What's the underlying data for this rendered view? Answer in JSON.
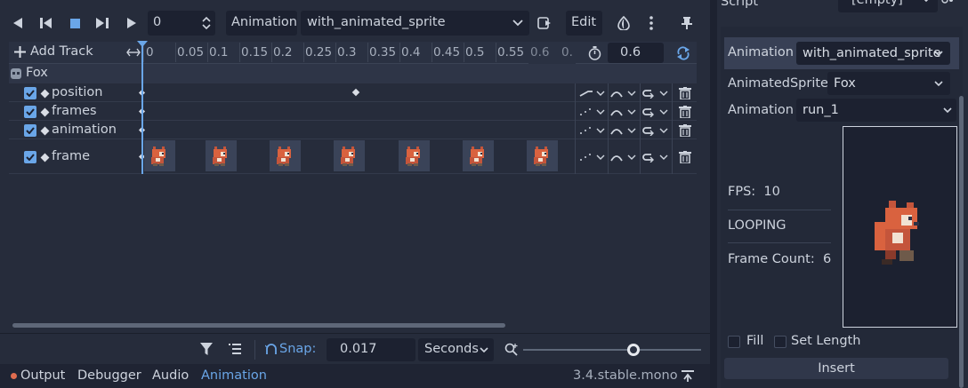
{
  "toolbar": {
    "frame_value": "0",
    "animation_label": "Animation",
    "animation_name": "with_animated_sprite",
    "edit_label": "Edit"
  },
  "timeline": {
    "add_track_label": "Add Track",
    "ticks": [
      "0",
      "0.05",
      "0.1",
      "0.15",
      "0.2",
      "0.25",
      "0.3",
      "0.35",
      "0.4",
      "0.45",
      "0.5",
      "0.55",
      "0.6",
      "0."
    ],
    "length_value": "0.6",
    "node_name": "Fox",
    "tracks": [
      {
        "name": "position"
      },
      {
        "name": "frames"
      },
      {
        "name": "animation"
      },
      {
        "name": "frame"
      }
    ]
  },
  "bottom_bar": {
    "snap_label": "Snap:",
    "snap_value": "0.017",
    "snap_unit": "Seconds"
  },
  "status_bar": {
    "tabs": [
      "Output",
      "Debugger",
      "Audio",
      "Animation"
    ],
    "version": "3.4.stable.mono"
  },
  "inspector": {
    "script_label": "Script",
    "script_value": "[empty]",
    "animation_label": "Animation",
    "animation_value": "with_animated_sprite",
    "animated_sprite_label": "AnimatedSprite",
    "animated_sprite_value": "Fox",
    "sub_animation_label": "Animation",
    "sub_animation_value": "run_1",
    "fps_label": "FPS:",
    "fps_value": "10",
    "looping_label": "LOOPING",
    "frame_count_label": "Frame Count:",
    "frame_count_value": "6",
    "fill_label": "Fill",
    "set_length_label": "Set Length",
    "insert_label": "Insert"
  },
  "colors": {
    "accent": "#6aa6e8",
    "panel": "#262c3b",
    "field": "#1c2130",
    "output_dot": "#e06c4f"
  }
}
